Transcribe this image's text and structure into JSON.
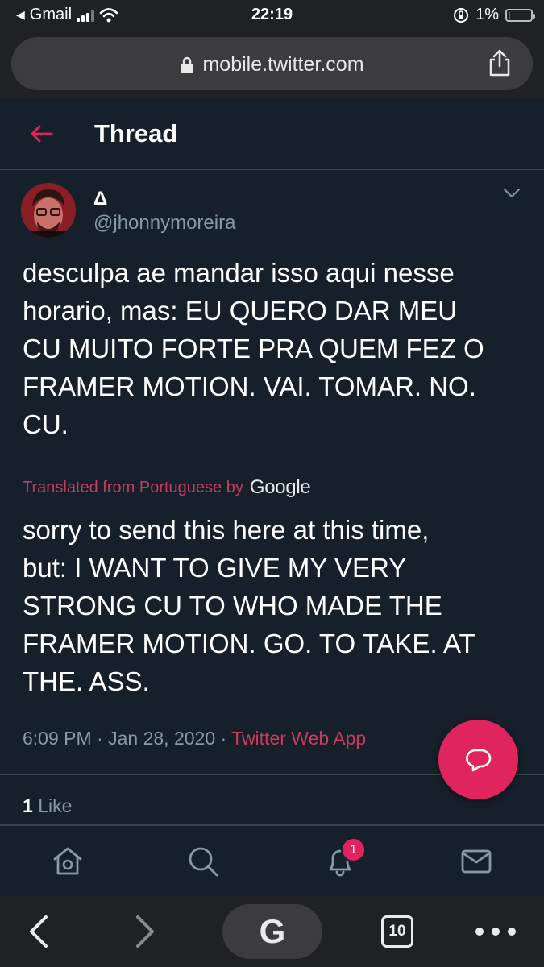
{
  "status_bar": {
    "carrier": "Gmail",
    "time": "22:19",
    "battery_percent": "1%",
    "battery_level": 0.01,
    "battery_color": "#e0245e"
  },
  "browser": {
    "url": "mobile.twitter.com",
    "tab_count": "10",
    "search_label": "G"
  },
  "header": {
    "title": "Thread"
  },
  "tweet": {
    "display_name": "Δ",
    "handle": "@jhonnymoreira",
    "text_lines": [
      "desculpa ae mandar isso aqui nesse",
      "horario, mas: EU QUERO DAR MEU",
      "CU MUITO FORTE PRA QUEM FEZ O",
      "FRAMER MOTION. VAI. TOMAR. NO.",
      "CU."
    ],
    "translation_label": "Translated from Portuguese by",
    "translation_provider": "Google",
    "translation_lines": [
      "sorry to send this here at this time,",
      "but: I WANT TO GIVE MY VERY",
      "STRONG CU TO WHO MADE THE",
      "FRAMER MOTION. GO. TO TAKE. AT",
      "THE. ASS."
    ],
    "time": "6:09 PM",
    "separator": "·",
    "date": "Jan 28, 2020",
    "source": "Twitter Web App",
    "like_count": "1",
    "like_label": "Like"
  },
  "nav": {
    "notification_count": "1"
  },
  "colors": {
    "background": "#15202b",
    "accent": "#e0245e",
    "muted_text": "#8899a6",
    "divider": "#38444d"
  }
}
